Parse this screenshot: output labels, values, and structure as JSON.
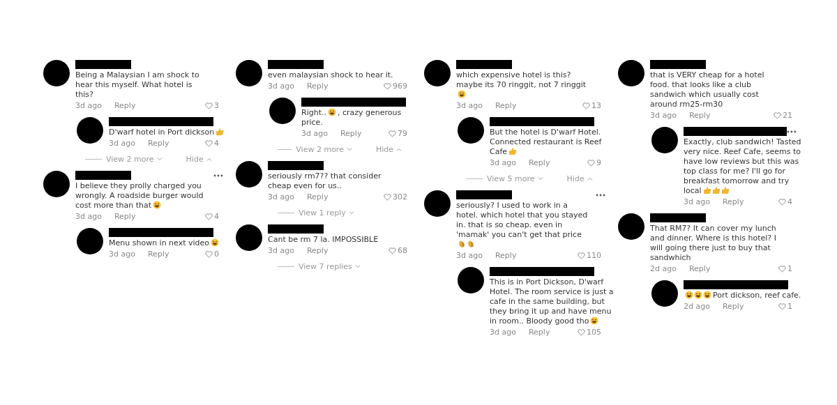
{
  "panels": [
    {
      "items": [
        {
          "kind": "comment",
          "text": "Being a Malaysian I am shock to hear this myself. What hotel is this?",
          "menu": false,
          "time": "3d ago",
          "reply": "Reply",
          "likes": "3"
        },
        {
          "kind": "reply",
          "text": "D'warf hotel in Port dickson",
          "emoji": [
            {
              "kind": "thumbs-up"
            }
          ],
          "menu": false,
          "time": "3d ago",
          "reply": "Reply",
          "likes": "4"
        },
        {
          "kind": "toggle",
          "more": "View 2 more",
          "hide": "Hide"
        },
        {
          "kind": "comment",
          "text": "I believe they prolly charged you wrongly. A roadside burger would cost more than that",
          "emoji": [
            {
              "kind": "laugh"
            }
          ],
          "menu": true,
          "time": "3d ago",
          "reply": "Reply",
          "likes": "4"
        },
        {
          "kind": "reply",
          "text": "Menu shown in next video",
          "emoji": [
            {
              "kind": "laugh"
            }
          ],
          "menu": false,
          "time": "3d ago",
          "reply": "Reply",
          "likes": "0"
        }
      ]
    },
    {
      "items": [
        {
          "kind": "comment",
          "text": "even malaysian shock to hear it.",
          "menu": false,
          "time": "3d ago",
          "reply": "Reply",
          "likes": "969"
        },
        {
          "kind": "reply",
          "text": "Right..",
          "emoji": [
            {
              "kind": "laugh"
            }
          ],
          "text_after": ", crazy generous price.",
          "menu": false,
          "time": "3d ago",
          "reply": "Reply",
          "likes": "79"
        },
        {
          "kind": "toggle",
          "more": "View 2 more",
          "hide": "Hide"
        },
        {
          "kind": "comment",
          "text": "seriously rm7?? that consider cheap even for us..",
          "menu": false,
          "time": "3d ago",
          "reply": "Reply",
          "likes": "302"
        },
        {
          "kind": "toggle",
          "more": "View 1 reply"
        },
        {
          "kind": "comment",
          "text": "Cant be rm 7 la. IMPOSSIBLE",
          "menu": false,
          "time": "3d ago",
          "reply": "Reply",
          "likes": "68"
        },
        {
          "kind": "toggle",
          "more": "View 7 replies"
        }
      ]
    },
    {
      "items": [
        {
          "kind": "comment",
          "text": "which expensive hotel is this? maybe its 70 ringgit, not 7 ringgit",
          "emoji": [
            {
              "kind": "laugh"
            }
          ],
          "menu": false,
          "time": "3d ago",
          "reply": "Reply",
          "likes": "13"
        },
        {
          "kind": "reply",
          "text": "But the hotel is D'warf Hotel. Connected restaurant is Reef Cafe",
          "emoji": [
            {
              "kind": "thumbs-up"
            }
          ],
          "menu": false,
          "time": "3d ago",
          "reply": "Reply",
          "likes": "9"
        },
        {
          "kind": "toggle",
          "more": "View 5 more",
          "hide": "Hide"
        },
        {
          "kind": "comment",
          "text": "seriously? I used to work in a hotel. which hotel that you stayed in. that is so cheap. even in 'mamak' you can't get that price",
          "emoji": [
            {
              "kind": "clap"
            },
            {
              "kind": "clap"
            }
          ],
          "menu": true,
          "time": "3d ago",
          "reply": "Reply",
          "likes": "110"
        },
        {
          "kind": "reply",
          "text": "This is in Port Dickson, D'warf Hotel. The room service is just a cafe in the same building, but they bring it up and have menu in room.. Bloody good tho",
          "emoji": [
            {
              "kind": "laugh"
            }
          ],
          "menu": false,
          "time": "3d ago",
          "reply": "Reply",
          "likes": "105"
        }
      ]
    },
    {
      "items": [
        {
          "kind": "comment",
          "text": "that is VERY cheap for a hotel food. that looks like a club sandwich which usually cost around rm25-rm30",
          "menu": false,
          "time": "3d ago",
          "reply": "Reply",
          "likes": "21"
        },
        {
          "kind": "reply",
          "text": "Exactly, club sandwich! Tasted very nice. Reef Cafe, seems to have low reviews but this was top class for me? I'll go for breakfast tomorrow and try local",
          "emoji": [
            {
              "kind": "thumbs-up"
            },
            {
              "kind": "thumbs-up"
            },
            {
              "kind": "thumbs-up"
            }
          ],
          "menu": true,
          "time": "3d ago",
          "reply": "Reply",
          "likes": "4"
        },
        {
          "kind": "comment",
          "text": "That RM7? It can cover my lunch and dinner. Where is this hotel? I will going there just to buy that sandwhich",
          "menu": false,
          "time": "2d ago",
          "reply": "Reply",
          "likes": "1"
        },
        {
          "kind": "reply",
          "emoji": [
            {
              "kind": "laugh"
            },
            {
              "kind": "laugh"
            },
            {
              "kind": "laugh"
            }
          ],
          "text_after": "Port dickson, reef cafe.",
          "menu": false,
          "time": "2d ago",
          "reply": "Reply",
          "likes": "1"
        }
      ]
    }
  ]
}
